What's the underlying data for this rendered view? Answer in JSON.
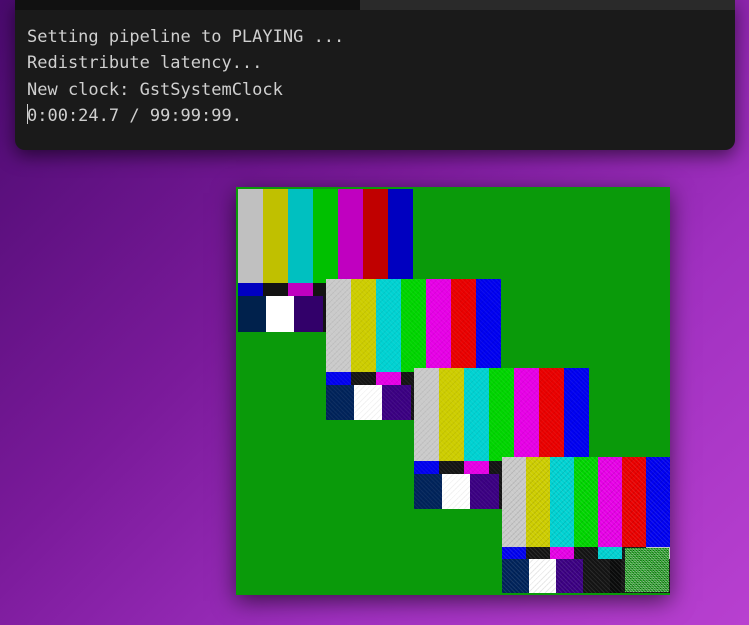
{
  "terminal": {
    "line1": "Setting pipeline to PLAYING ...",
    "line2": "Redistribute latency...",
    "line3": "New clock: GstSystemClock",
    "line4_elapsed": "0:00:24.7",
    "line4_sep": " / ",
    "line4_total": "99:99:99."
  },
  "video": {
    "background_color": "#0a9a0a",
    "pattern": "smpte-color-bars",
    "instances": 4,
    "smpte_top_colors": [
      "white",
      "yellow",
      "cyan",
      "green",
      "magenta",
      "red",
      "blue"
    ],
    "smpte_mid_colors": [
      "blue",
      "black",
      "magenta",
      "black",
      "cyan",
      "black",
      "white"
    ],
    "smpte_bot_segments": [
      "-I",
      "white",
      "+Q",
      "black",
      "black-4",
      "black",
      "black+4",
      "black"
    ]
  }
}
